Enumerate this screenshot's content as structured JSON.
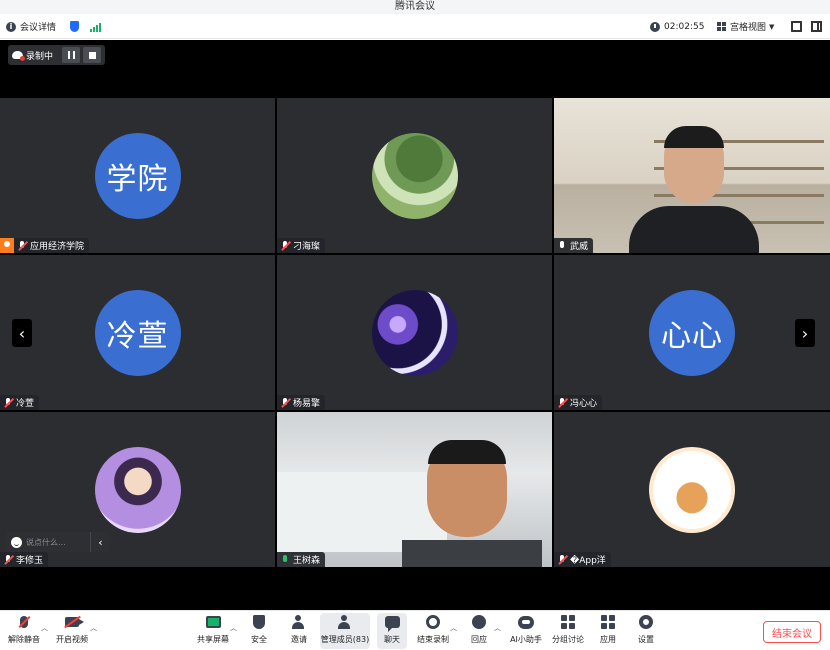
{
  "window": {
    "title": "腾讯会议"
  },
  "infobar": {
    "meeting_info": "会议详情",
    "timer": "02:02:55",
    "view_mode": "宫格视图"
  },
  "recording": {
    "label": "录制中"
  },
  "participants": [
    {
      "name": "应用经济学院",
      "avatar_text": "学院",
      "host": true,
      "mic": "muted",
      "video": false
    },
    {
      "name": "刁海璨",
      "avatar_image": "tree-photo",
      "mic": "muted",
      "video": false
    },
    {
      "name": "武威",
      "mic": "on-white",
      "video": true,
      "active_speaker": true
    },
    {
      "name": "冷萱",
      "avatar_text": "冷萱",
      "mic": "muted",
      "video": false
    },
    {
      "name": "杨易擎",
      "avatar_image": "space-art",
      "mic": "muted",
      "video": false
    },
    {
      "name": "冯心心",
      "avatar_text": "心心",
      "mic": "muted",
      "video": false
    },
    {
      "name": "李修玉",
      "avatar_image": "cartoon-girl",
      "mic": "muted",
      "video": false
    },
    {
      "name": "王树森",
      "mic": "on",
      "video": true
    },
    {
      "name": "�App洋",
      "avatar_image": "tiger-sticker",
      "mic": "muted",
      "video": false
    }
  ],
  "chat_input": {
    "placeholder": "说点什么..."
  },
  "toolbar": {
    "unmute": "解除静音",
    "start_video": "开启视频",
    "share_screen": "共享屏幕",
    "security": "安全",
    "invite": "邀请",
    "manage_members": "管理成员(83)",
    "chat": "聊天",
    "end_recording": "结束录制",
    "reactions": "回应",
    "ai_assistant": "AI小助手",
    "breakout": "分组讨论",
    "apps": "应用",
    "settings": "设置",
    "end_meeting": "结束会议"
  },
  "colors": {
    "accent": "#1f6bff",
    "avatar_blue": "#3a6fd1",
    "active_border": "#28b262",
    "end_red": "#ff4d4f",
    "host_orange": "#ff7d1a"
  }
}
